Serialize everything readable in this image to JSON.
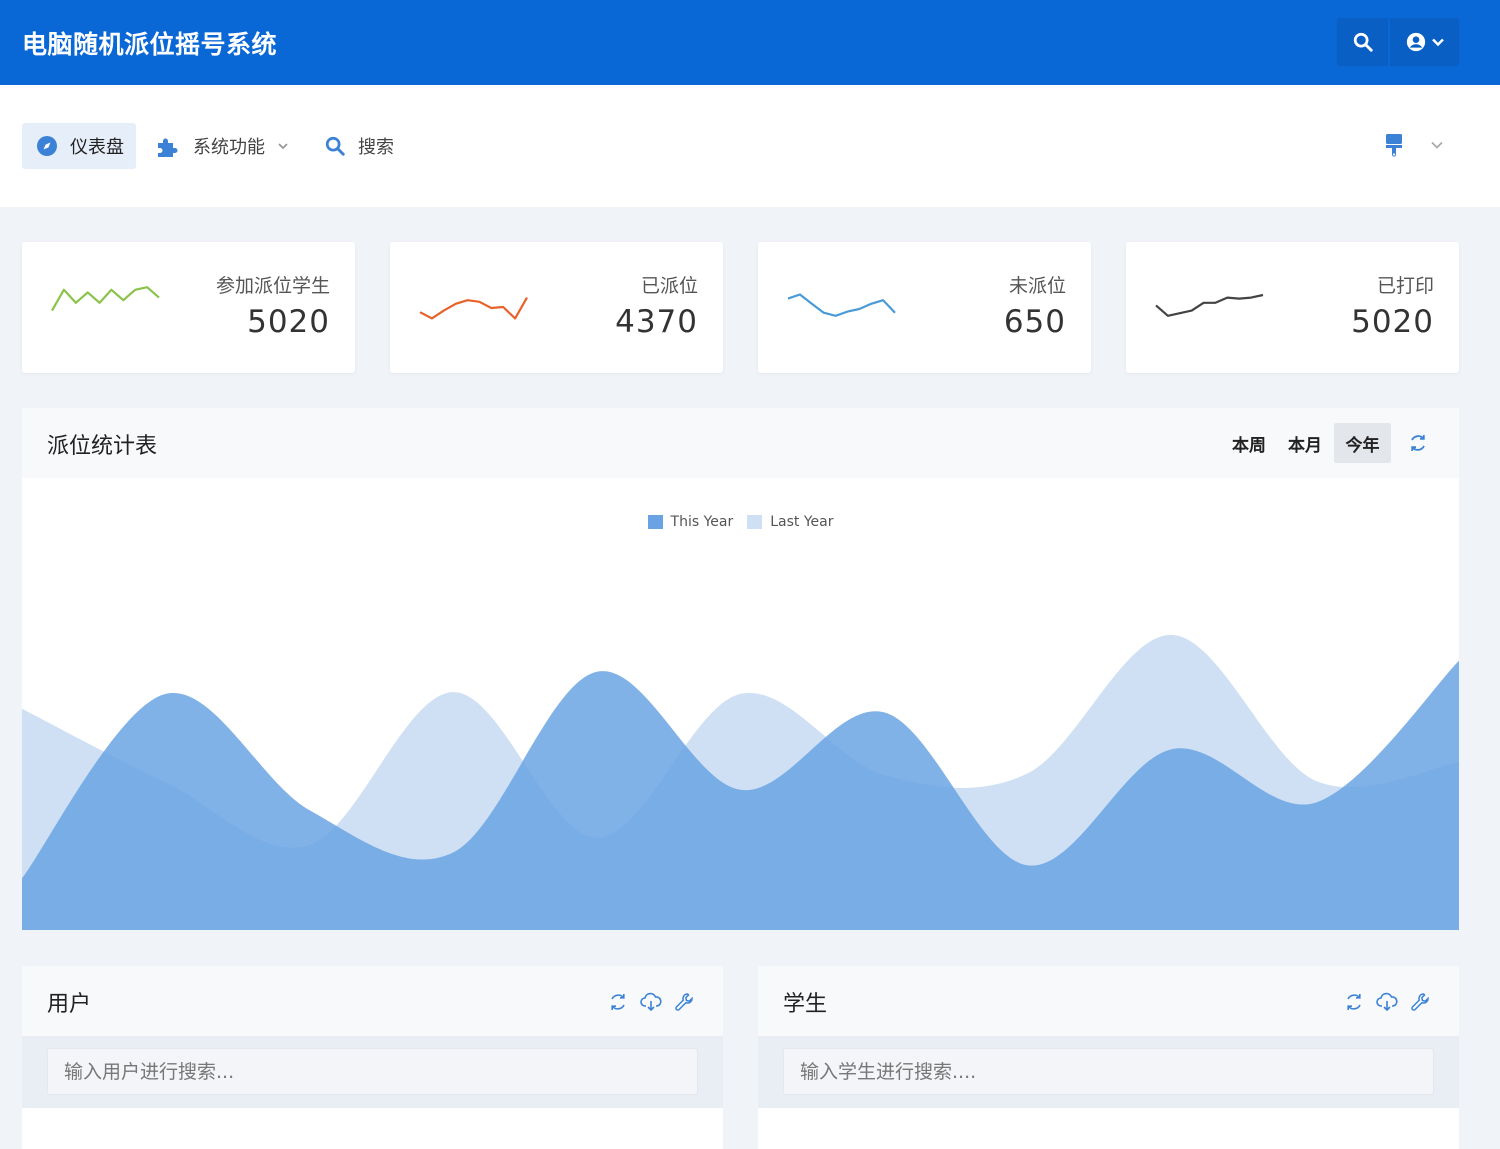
{
  "app": {
    "title": "电脑随机派位摇号系统"
  },
  "nav": {
    "items": [
      {
        "label": "仪表盘",
        "icon": "compass-icon"
      },
      {
        "label": "系统功能",
        "icon": "puzzle-icon"
      },
      {
        "label": "搜索",
        "icon": "search-icon"
      }
    ]
  },
  "stats": [
    {
      "label": "参加派位学生",
      "value": "5020",
      "color": "#8bc34a",
      "spark": [
        45,
        85,
        60,
        80,
        60,
        85,
        65,
        85,
        90,
        70
      ]
    },
    {
      "label": "已派位",
      "value": "4370",
      "color": "#e8622b",
      "spark": [
        42,
        30,
        45,
        58,
        65,
        62,
        50,
        52,
        30,
        70
      ]
    },
    {
      "label": "未派位",
      "value": "650",
      "color": "#4a9ad8",
      "spark": [
        68,
        76,
        58,
        41,
        35,
        43,
        48,
        58,
        65,
        41
      ]
    },
    {
      "label": "已打印",
      "value": "5020",
      "color": "#444444",
      "spark": [
        55,
        35,
        40,
        45,
        60,
        60,
        70,
        68,
        70,
        75
      ]
    }
  ],
  "chart_card": {
    "title": "派位统计表",
    "periods": [
      "本周",
      "本月",
      "今年"
    ],
    "active_period": "今年"
  },
  "chart_data": {
    "type": "area",
    "series": [
      {
        "name": "This Year",
        "color": "#6aa3e3",
        "values": [
          28,
          128,
          65,
          42,
          140,
          76,
          118,
          35,
          98,
          69,
          146
        ]
      },
      {
        "name": "Last Year",
        "color": "#cfe0f5",
        "values": [
          120,
          80,
          46,
          129,
          50,
          128,
          84,
          85,
          160,
          81,
          91
        ]
      }
    ],
    "ylim": [
      0,
      180
    ],
    "grid": false,
    "legend": "top-center"
  },
  "users_card": {
    "title": "用户",
    "placeholder": "输入用户进行搜索..."
  },
  "students_card": {
    "title": "学生",
    "placeholder": "输入学生进行搜索...."
  }
}
